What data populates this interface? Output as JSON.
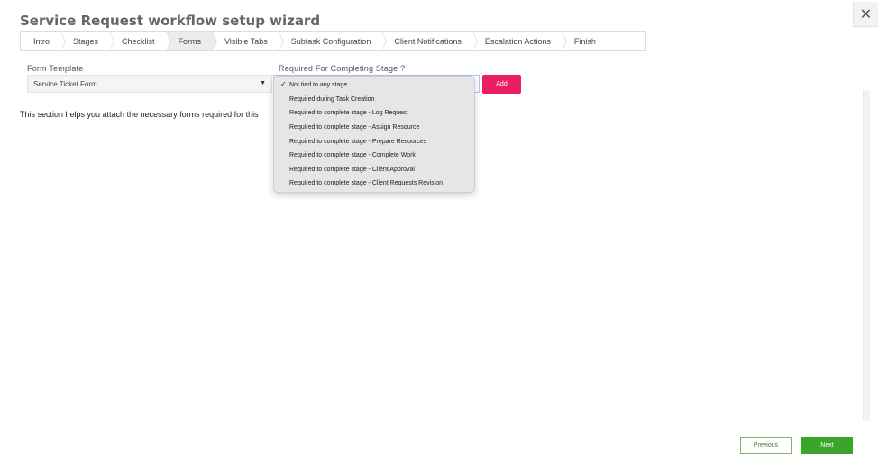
{
  "title": "Service Request workflow setup wizard",
  "close_icon": "close-icon",
  "steps": [
    {
      "label": "Intro"
    },
    {
      "label": "Stages"
    },
    {
      "label": "Checklist"
    },
    {
      "label": "Forms",
      "active": true
    },
    {
      "label": "Visible Tabs"
    },
    {
      "label": "Subtask Configuration"
    },
    {
      "label": "Client Notifications"
    },
    {
      "label": "Escalation Actions"
    },
    {
      "label": "Finish"
    }
  ],
  "form": {
    "template_label": "Form Template",
    "template_value": "Service Ticket Form",
    "stage_label": "Required For Completing Stage ?",
    "add_label": "Add"
  },
  "help_text": "This section helps you attach the necessary forms required for this",
  "dropdown": {
    "options": [
      {
        "label": "Not tied to any stage",
        "selected": true
      },
      {
        "label": "Required during Task Creation"
      },
      {
        "label": "Required to complete stage - Log Request"
      },
      {
        "label": "Required to complete stage - Assign Resource"
      },
      {
        "label": "Required to complete stage - Prepare Resources"
      },
      {
        "label": "Required to complete stage - Complete Work"
      },
      {
        "label": "Required to complete stage - Client Approval"
      },
      {
        "label": "Required to complete stage - Client Requests Revision"
      }
    ]
  },
  "footer": {
    "previous_label": "Previous",
    "next_label": "Next"
  },
  "colors": {
    "accent_add": "#e91e63",
    "next_green": "#3aa52a"
  }
}
